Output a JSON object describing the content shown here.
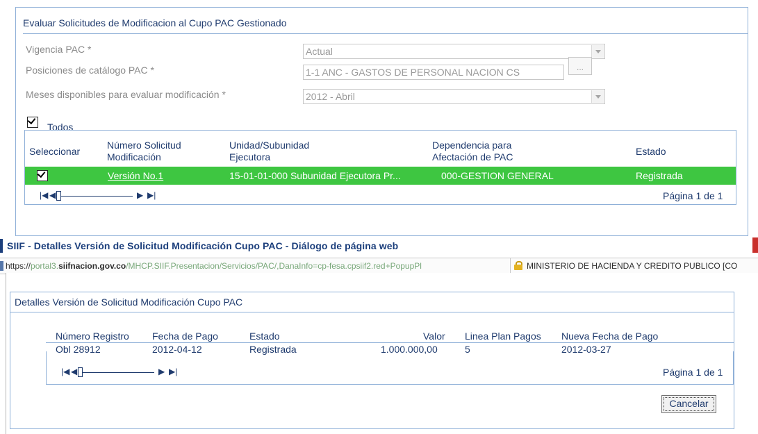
{
  "form": {
    "title": "Evaluar Solicitudes de Modificacion al Cupo PAC Gestionado",
    "vigencia": {
      "label": "Vigencia PAC *",
      "value": "Actual"
    },
    "posiciones": {
      "label": "Posiciones de catálogo PAC *",
      "value": "1-1 ANC - GASTOS DE PERSONAL NACION CS",
      "button": "..."
    },
    "meses": {
      "label": "Meses disponibles para evaluar modificación *",
      "value": "2012 - Abril"
    },
    "todos_label": "Todos",
    "todos_checked": true
  },
  "grid": {
    "headers": {
      "seleccionar": "Seleccionar",
      "numero_1": "Número Solicitud",
      "numero_2": "Modificación",
      "unidad_1": "Unidad/Subunidad",
      "unidad_2": "Ejecutora",
      "dependencia_1": "Dependencia para",
      "dependencia_2": "Afectación de PAC",
      "estado": "Estado"
    },
    "rows": [
      {
        "selected": true,
        "numero": "Versión No.1",
        "unidad": "15-01-01-000 Subunidad Ejecutora Pr...",
        "dependencia": "000-GESTION GENERAL",
        "estado": "Registrada"
      }
    ],
    "page_text": "Página 1 de 1",
    "row_color": "#3ec641"
  },
  "dialog": {
    "title": "SIIF - Detalles Versión de Solicitud Modificación Cupo PAC - Diálogo de página web",
    "url_prefix": "https://",
    "url_domain_start": "portal3.",
    "url_domain": "siifnacion.gov.co",
    "url_rest": "/MHCP.SIIF.Presentacion/Servicios/PAC/,DanaInfo=cp-fesa.cpsiif2.red+PopupPl",
    "org": "MINISTERIO DE HACIENDA Y CREDITO PUBLICO [CO"
  },
  "details": {
    "title": "Detalles Versión de Solicitud Modificación Cupo PAC",
    "headers": {
      "numero": "Número Registro",
      "fecha": "Fecha de Pago",
      "estado": "Estado",
      "valor": "Valor",
      "linea": "Linea Plan Pagos",
      "nueva": "Nueva Fecha de Pago"
    },
    "rows": [
      {
        "numero": "Obl 28912",
        "fecha": "2012-04-12",
        "estado": "Registrada",
        "valor": "1.000.000,00",
        "linea": "5",
        "nueva": "2012-03-27"
      }
    ],
    "page_text": "Página 1 de 1",
    "cancel_label": "Cancelar"
  }
}
